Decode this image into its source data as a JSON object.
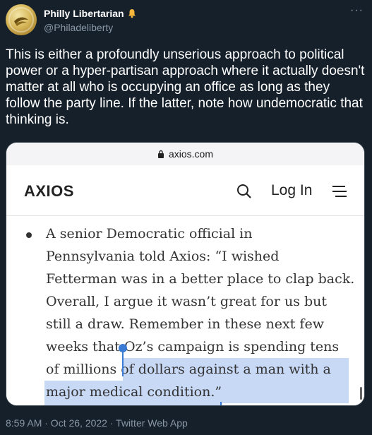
{
  "author": {
    "display_name": "Philly Libertarian",
    "handle": "@Philadeliberty",
    "badge_icon": "bell-icon",
    "badge_color": "#f6b73c"
  },
  "tweet": {
    "text": "This is either a profoundly unserious approach to political power or a hyper-partisan approach where it actually doesn't matter at all who is occupying an office as long as they follow the party line. If the latter, note how undemocratic that thinking is.",
    "timestamp": "8:59 AM · Oct 26, 2022 · Twitter Web App"
  },
  "screenshot": {
    "url": "axios.com",
    "site_logo": "AXIOS",
    "login_label": "Log In",
    "article": {
      "line1": "A senior Democratic official in",
      "line2": "Pennsylvania told Axios: “I wished",
      "line3": "Fetterman was in a better place to clap back.",
      "line4": "Overall, I argue it wasn’t great for us but",
      "line5": "still a draw. Remember in these next few",
      "line6_plain": "weeks that ",
      "line6_selected": "Oz’s campaign is spending tens",
      "line7": "of millions of dollars against a man with a",
      "line8": "major medical condition.”"
    },
    "selection_color": "#c8d9f6",
    "handle_color": "#3a7bd5"
  },
  "colors": {
    "background": "#15202b",
    "secondary_text": "#8b98a5"
  }
}
